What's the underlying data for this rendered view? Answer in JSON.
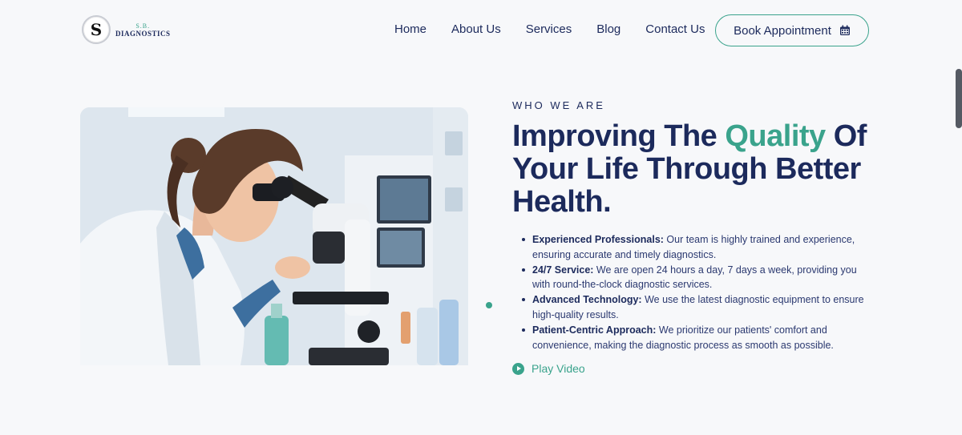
{
  "header": {
    "logo": {
      "mark": "S",
      "top_text": "S.B.",
      "bottom_text": "DIAGNOSTICS"
    },
    "nav": [
      {
        "label": "Home"
      },
      {
        "label": "About Us"
      },
      {
        "label": "Services"
      },
      {
        "label": "Blog"
      },
      {
        "label": "Contact Us"
      }
    ],
    "cta": {
      "label": "Book Appointment",
      "icon": "calendar-icon"
    }
  },
  "hero": {
    "image": {
      "subject": "lab-scientist-with-microscope"
    },
    "eyebrow": "WHO WE ARE",
    "headline": {
      "before": "Improving The ",
      "accent": "Quality",
      "after": " Of Your Life Through Better Health."
    },
    "features": [
      {
        "title": "Experienced Professionals:",
        "text": " Our team is highly trained and experience, ensuring accurate and timely diagnostics."
      },
      {
        "title": "24/7 Service:",
        "text": " We are open 24 hours a day, 7 days a week, providing you with round-the-clock diagnostic services."
      },
      {
        "title": "Advanced Technology:",
        "text": " We use the latest diagnostic equipment to ensure high-quality results."
      },
      {
        "title": "Patient-Centric Approach:",
        "text": " We prioritize our patients' comfort and convenience, making the diagnostic process as smooth as possible."
      }
    ],
    "play_video": {
      "label": "Play Video",
      "icon": "play-circle-icon"
    }
  },
  "colors": {
    "accent": "#3aa38c",
    "navy": "#1c2a5c",
    "background": "#f7f8fa"
  }
}
